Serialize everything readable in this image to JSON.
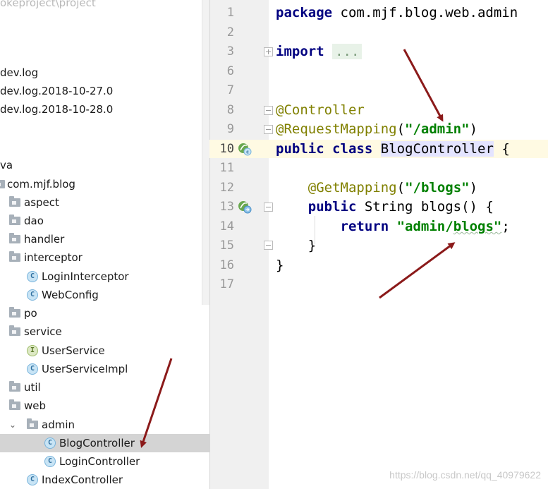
{
  "tree": {
    "path_fragment": "okeproject\\project",
    "items": [
      {
        "label": "dev.log"
      },
      {
        "label": "dev.log.2018-10-27.0"
      },
      {
        "label": "dev.log.2018-10-28.0"
      },
      {
        "label": "va"
      },
      {
        "label": "com.mjf.blog"
      },
      {
        "label": "aspect"
      },
      {
        "label": "dao"
      },
      {
        "label": "handler"
      },
      {
        "label": "interceptor"
      },
      {
        "label": "LoginInterceptor",
        "icon": "class-icon"
      },
      {
        "label": "WebConfig",
        "icon": "class-icon"
      },
      {
        "label": "po"
      },
      {
        "label": "service"
      },
      {
        "label": "UserService",
        "icon": "interface-icon"
      },
      {
        "label": "UserServiceImpl",
        "icon": "class-icon"
      },
      {
        "label": "util"
      },
      {
        "label": "web"
      },
      {
        "label": "admin"
      },
      {
        "label": "BlogController",
        "icon": "class-icon",
        "selected": true
      },
      {
        "label": "LoginController",
        "icon": "class-icon"
      },
      {
        "label": "IndexController",
        "icon": "class-icon"
      }
    ]
  },
  "editor": {
    "line_numbers": [
      "1",
      "2",
      "3",
      "6",
      "7",
      "8",
      "9",
      "10",
      "11",
      "12",
      "13",
      "14",
      "15",
      "16",
      "17"
    ],
    "current_line": "10",
    "code": {
      "l1_kw": "package",
      "l1_rest": " com.mjf.blog.web.admin",
      "l3_kw": "import",
      "l3_fold": "...",
      "l8_ann": "@Controller",
      "l9_ann": "@RequestMapping",
      "l9_open": "(",
      "l9_str": "\"/admin\"",
      "l9_close": ")",
      "l10_kw1": "public",
      "l10_kw2": "class",
      "l10_name": "BlogController",
      "l10_brace": " {",
      "l12_ann": "@GetMapping",
      "l12_open": "(",
      "l12_str": "\"/blogs\"",
      "l12_close": ")",
      "l13_kw": "public",
      "l13_rest": " String blogs() {",
      "l14_kw": "return",
      "l14_str_a": "\"admin/",
      "l14_str_b": "blogs\"",
      "l14_semi": ";",
      "l15_brace": "}",
      "l16_brace": "}"
    }
  },
  "watermark": "https://blog.csdn.net/qq_40979622",
  "colors": {
    "keyword": "#000080",
    "annotation": "#808000",
    "string": "#008000",
    "arrow": "#8b1a1a",
    "selection": "#d4d4d4",
    "current_line": "#fffae3"
  }
}
